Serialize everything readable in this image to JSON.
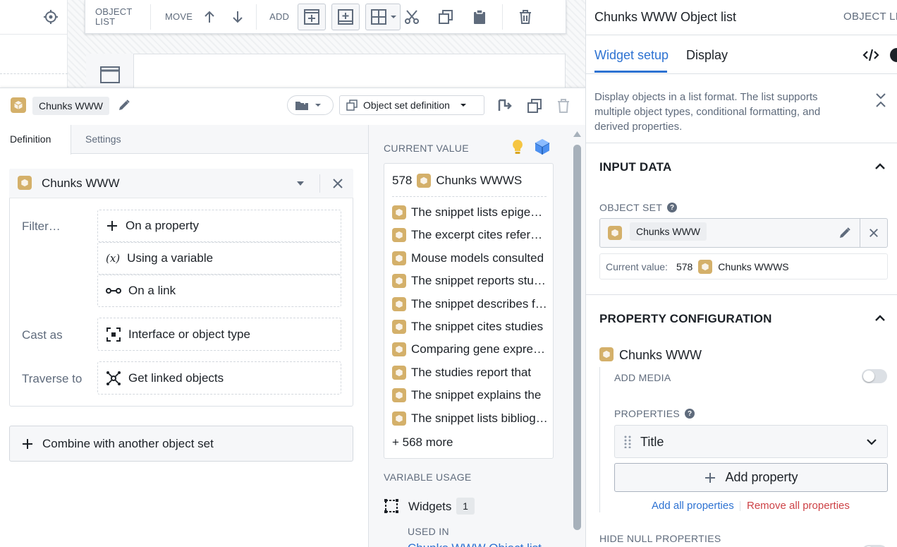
{
  "toolbar": {
    "object_list_line1": "OBJECT",
    "object_list_line2": "LIST",
    "move_label": "MOVE",
    "add_label": "ADD"
  },
  "editor": {
    "variable_name": "Chunks WWW",
    "definition_type": "Object set definition",
    "tabs": [
      {
        "label": "Definition"
      },
      {
        "label": "Settings"
      }
    ],
    "object_type": "Chunks WWW",
    "filter_label": "Filter…",
    "filter_options": [
      {
        "label": "On a property"
      },
      {
        "label": "Using a variable"
      },
      {
        "label": "On a link"
      }
    ],
    "cast_label": "Cast as",
    "cast_option": "Interface or object type",
    "traverse_label": "Traverse to",
    "traverse_option": "Get linked objects",
    "combine_label": "Combine with another object set"
  },
  "current_value": {
    "caption": "CURRENT VALUE",
    "count": "578",
    "type_name": "Chunks WWWS",
    "items": [
      "The snippet lists epigenetic studies",
      "The excerpt cites references",
      "Mouse models consulted",
      "The snippet reports studies",
      "The snippet describes findings",
      "The snippet cites studies",
      "Comparing gene expression",
      "The studies report that",
      "The snippet explains the",
      "The snippet lists bibliography"
    ],
    "more": "+ 568 more",
    "variable_usage_caption": "VARIABLE USAGE",
    "widgets_label": "Widgets",
    "widgets_count": "1",
    "used_in_caption": "USED IN",
    "used_in_link": "Chunks WWW Object list"
  },
  "right_panel": {
    "title": "Chunks WWW Object list",
    "header_right": "OBJECT LIST",
    "tabs": [
      {
        "label": "Widget setup"
      },
      {
        "label": "Display"
      }
    ],
    "description": "Display objects in a list format. The list supports multiple object types, conditional formatting, and derived properties.",
    "input_data_title": "INPUT DATA",
    "object_set_caption": "OBJECT SET",
    "object_set_value": "Chunks WWW",
    "current_value_label": "Current value:",
    "current_value_count": "578",
    "current_value_type": "Chunks WWWS",
    "property_config_title": "PROPERTY CONFIGURATION",
    "object_type": "Chunks WWW",
    "add_media_caption": "ADD MEDIA",
    "properties_caption": "PROPERTIES",
    "property_row": "Title",
    "add_property_label": "Add property",
    "add_all_label": "Add all properties",
    "remove_all_label": "Remove all properties",
    "hide_null_caption": "HIDE NULL PROPERTIES"
  },
  "colors": {
    "accent_blue": "#2d72d2",
    "object_icon": "#d4b06a",
    "danger": "#cd4246",
    "text_muted": "#5f6b7c"
  }
}
